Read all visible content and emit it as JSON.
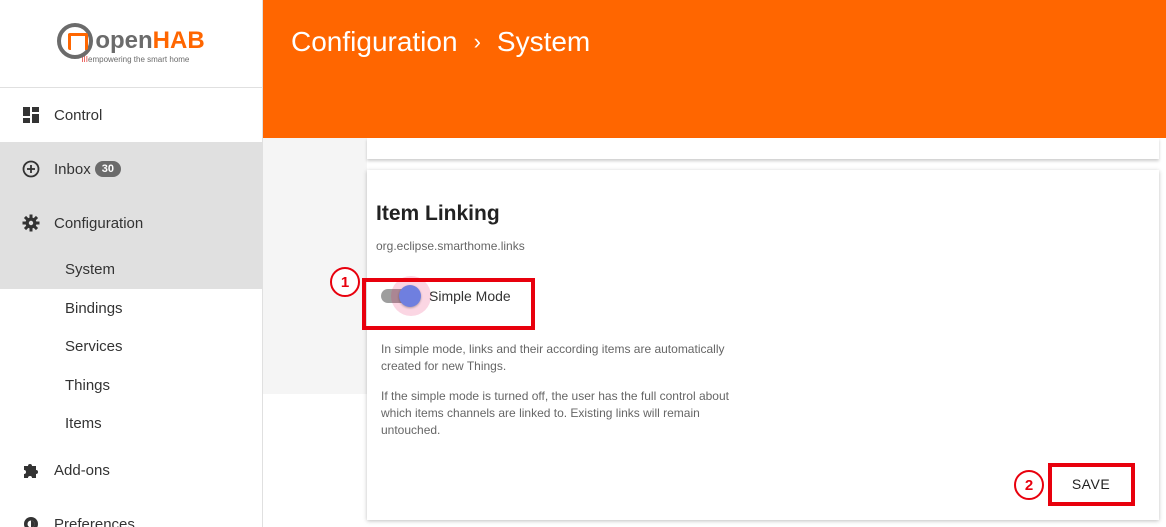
{
  "logo": {
    "open": "open",
    "hab": "HAB",
    "tag_prefix": "III",
    "tag": "empowering the smart home"
  },
  "sidebar": {
    "items": [
      {
        "label": "Control"
      },
      {
        "label": "Inbox",
        "badge": "30"
      },
      {
        "label": "Configuration"
      },
      {
        "label": "Add-ons"
      },
      {
        "label": "Preferences"
      }
    ],
    "config_sub": [
      {
        "label": "System"
      },
      {
        "label": "Bindings"
      },
      {
        "label": "Services"
      },
      {
        "label": "Things"
      },
      {
        "label": "Items"
      }
    ]
  },
  "header": {
    "crumb1": "Configuration",
    "separator": "›",
    "crumb2": "System"
  },
  "card": {
    "title": "Item Linking",
    "subtitle": "org.eclipse.smarthome.links",
    "toggle_label": "Simple Mode",
    "toggle_on": true,
    "desc1": "In simple mode, links and their according items are automatically created for new Things.",
    "desc2": "If the simple mode is turned off, the user has the full control about which items channels are linked to. Existing links will remain untouched.",
    "save_label": "SAVE"
  },
  "annotations": {
    "n1": "1",
    "n2": "2"
  },
  "colors": {
    "accent": "#ff6600",
    "highlight": "#e8000d",
    "toggle": "#6f7fdf"
  }
}
